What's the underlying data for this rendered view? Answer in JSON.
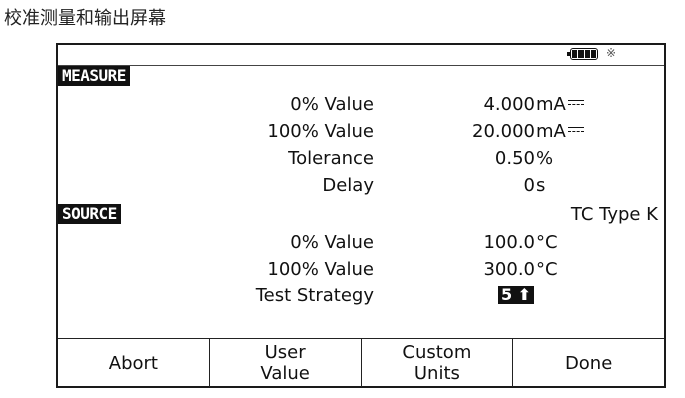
{
  "caption": "校准测量和输出屏幕",
  "status": {
    "battery_icon": "battery-full-icon",
    "backlight_icon": "backlight-icon",
    "backlight_glyph": "※"
  },
  "measure": {
    "header": "MEASURE",
    "rows": [
      {
        "label": "0% Value",
        "value": "4.000",
        "unit": "mA"
      },
      {
        "label": "100% Value",
        "value": "20.000",
        "unit": "mA"
      },
      {
        "label": "Tolerance",
        "value": "0.50",
        "unit": "%"
      },
      {
        "label": "Delay",
        "value": "0",
        "unit": "s"
      }
    ]
  },
  "source": {
    "header": "SOURCE",
    "type": "TC Type K",
    "rows": [
      {
        "label": "0% Value",
        "value": "100.0",
        "unit": "°C"
      },
      {
        "label": "100% Value",
        "value": "300.0",
        "unit": "°C"
      },
      {
        "label": "Test Strategy",
        "value": "5 ⬆"
      }
    ]
  },
  "softkeys": [
    "Abort",
    "User\nValue",
    "Custom\nUnits",
    "Done"
  ]
}
